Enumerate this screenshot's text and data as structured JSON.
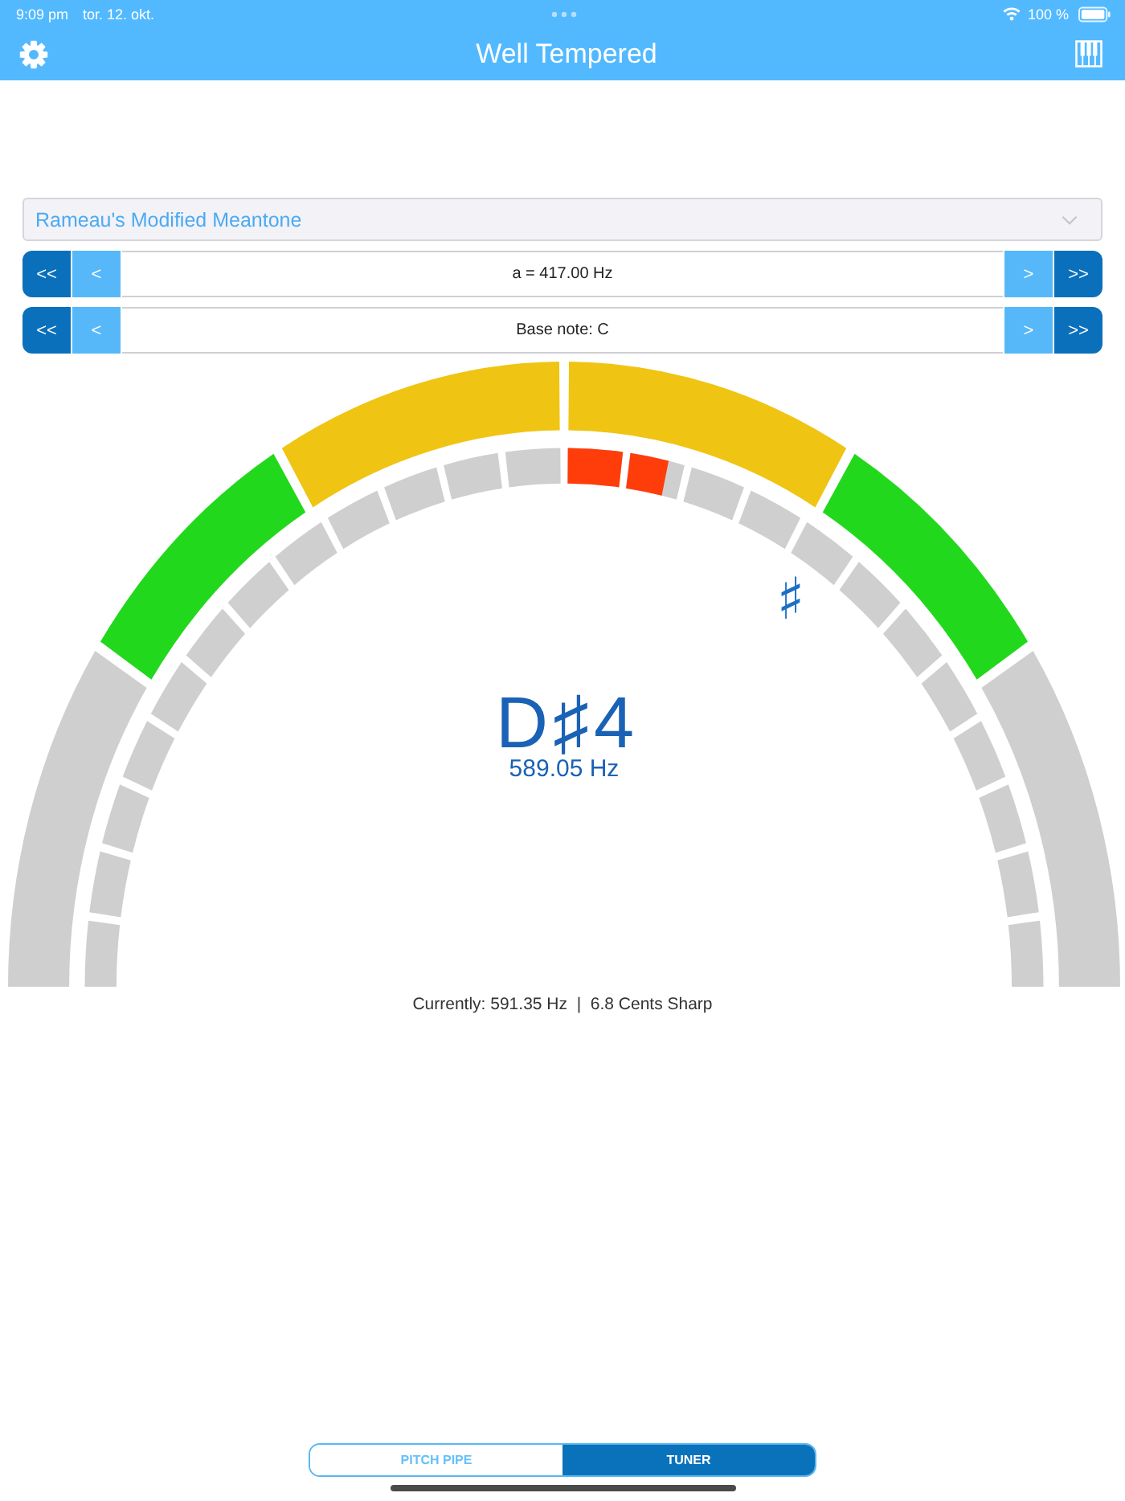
{
  "status_bar": {
    "time": "9:09 pm",
    "date": "tor. 12. okt.",
    "battery": "100 %"
  },
  "nav_bar": {
    "title": "Well Tempered"
  },
  "temperament_select": {
    "value": "Rameau's Modified Meantone"
  },
  "steppers": [
    {
      "left_buttons": [
        {
          "label": "<<",
          "kind": "jump"
        },
        {
          "label": "<",
          "kind": "step"
        }
      ],
      "value": "a = 417.00 Hz",
      "right_buttons": [
        {
          "label": ">",
          "kind": "step"
        },
        {
          "label": ">>",
          "kind": "jump"
        }
      ]
    },
    {
      "left_buttons": [
        {
          "label": "<<",
          "kind": "jump"
        },
        {
          "label": "<",
          "kind": "step"
        }
      ],
      "value": "Base note: C",
      "right_buttons": [
        {
          "label": ">",
          "kind": "step"
        },
        {
          "label": ">>",
          "kind": "jump"
        }
      ]
    }
  ],
  "gauge": {
    "sharp_sign": "♯",
    "note": "D♯4",
    "frequency": "589.05 Hz",
    "sharp_meter": {
      "level": 0.14
    }
  },
  "reading": "Currently: 591.35 Hz  |  6.8 Cents Sharp",
  "mode_tabs": [
    {
      "label": "PITCH PIPE",
      "selected": false
    },
    {
      "label": "TUNER",
      "selected": true
    }
  ]
}
